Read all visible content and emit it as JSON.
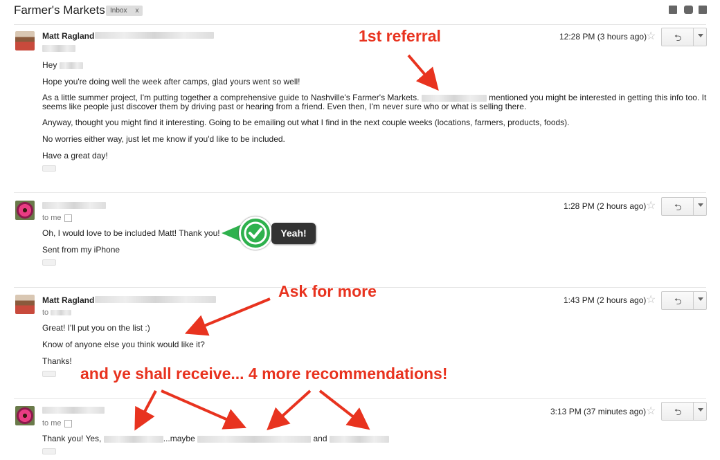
{
  "thread": {
    "subject": "Farmer's Markets",
    "label": "Inbox",
    "label_close": "x"
  },
  "messages": [
    {
      "sender": "Matt Ragland",
      "time": "12:28 PM (3 hours ago)",
      "greeting": "Hey",
      "para1": "Hope you're doing well the week after camps, glad yours went so well!",
      "para2a": "As a little summer project, I'm putting together a comprehensive guide to Nashville's Farmer's Markets.",
      "para2b": "mentioned you might be interested in getting this info too. It",
      "para2c": "seems like people just discover them by driving past or hearing from a friend. Even then, I'm never sure who or what is selling there.",
      "para3": "Anyway, thought you might find it interesting. Going to be emailing out what I find in the next couple weeks (locations, farmers, products, foods).",
      "para4": "No worries either way, just let me know if you'd like to be included.",
      "para5": "Have a great day!"
    },
    {
      "time": "1:28 PM (2 hours ago)",
      "to": "to me",
      "para1": "Oh, I would love to be included Matt! Thank you!",
      "para2": "Sent from my iPhone"
    },
    {
      "sender": "Matt Ragland",
      "time": "1:43 PM (2 hours ago)",
      "to": "to",
      "para1": "Great! I'll put you on the list :)",
      "para2": "Know of anyone else you think would like it?",
      "para3": "Thanks!"
    },
    {
      "time": "3:13 PM (37 minutes ago)",
      "to": "to me",
      "text_a": "Thank you! Yes,",
      "text_b": "...maybe",
      "text_c": "and"
    }
  ],
  "annotations": {
    "first_referral": "1st referral",
    "yeah": "Yeah!",
    "ask": "Ask for more",
    "receive": "and ye shall receive... 4 more recommendations!"
  },
  "icons": {
    "reply": "reply-arrow-icon",
    "star": "star-icon",
    "more": "chevron-down-icon",
    "archive": "archive-icon",
    "print": "print-icon",
    "new_window": "new-window-icon"
  },
  "colors": {
    "annotation": "#e8331f",
    "check": "#2eb14d"
  }
}
